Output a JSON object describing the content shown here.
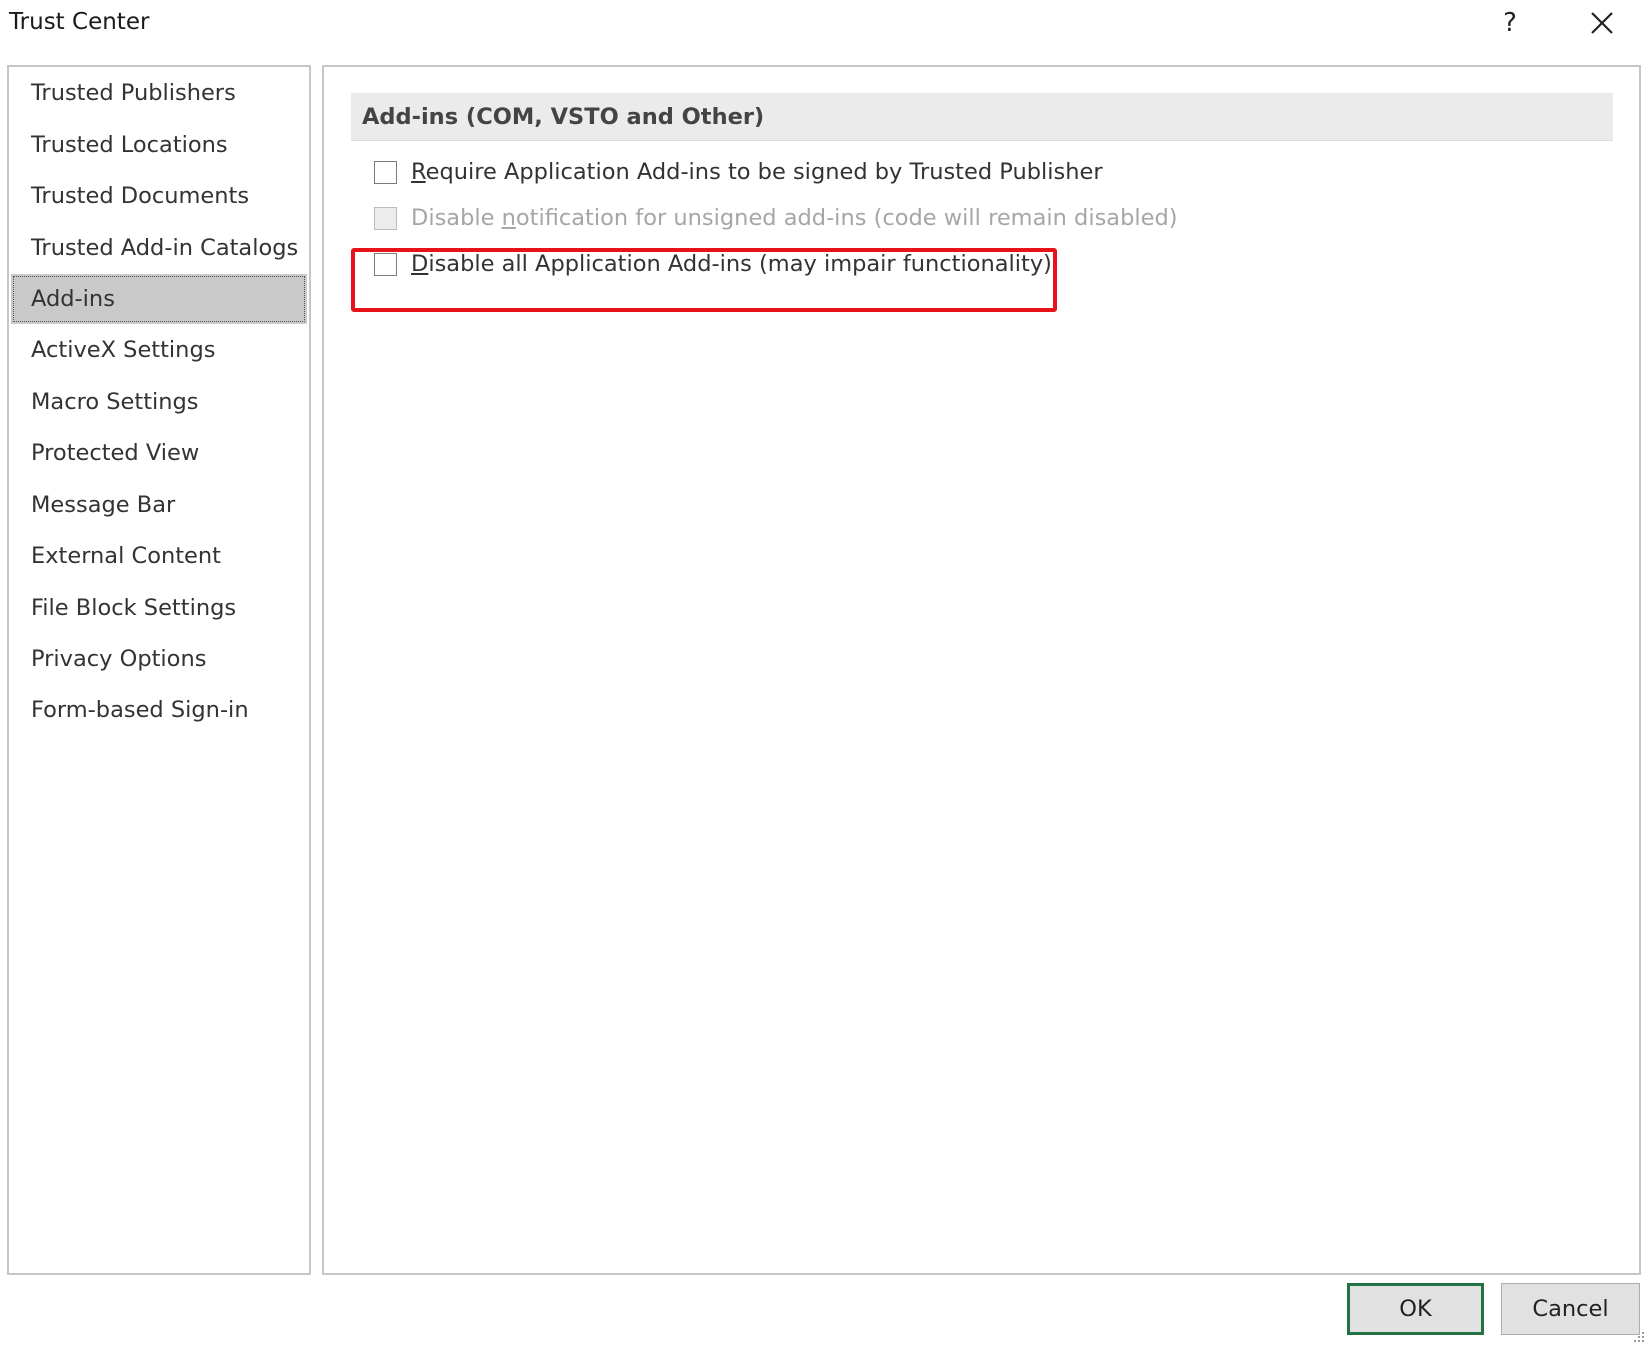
{
  "window": {
    "title": "Trust Center",
    "help_label": "?",
    "close_icon": "close-icon"
  },
  "nav": {
    "items": [
      {
        "label": "Trusted Publishers",
        "selected": false
      },
      {
        "label": "Trusted Locations",
        "selected": false
      },
      {
        "label": "Trusted Documents",
        "selected": false
      },
      {
        "label": "Trusted Add-in Catalogs",
        "selected": false
      },
      {
        "label": "Add-ins",
        "selected": true
      },
      {
        "label": "ActiveX Settings",
        "selected": false
      },
      {
        "label": "Macro Settings",
        "selected": false
      },
      {
        "label": "Protected View",
        "selected": false
      },
      {
        "label": "Message Bar",
        "selected": false
      },
      {
        "label": "External Content",
        "selected": false
      },
      {
        "label": "File Block Settings",
        "selected": false
      },
      {
        "label": "Privacy Options",
        "selected": false
      },
      {
        "label": "Form-based Sign-in",
        "selected": false
      }
    ]
  },
  "main": {
    "section_title": "Add-ins (COM, VSTO and Other)",
    "options": [
      {
        "accel": "R",
        "rest": "equire Application Add-ins to be signed by Trusted Publisher",
        "checked": false,
        "enabled": true
      },
      {
        "pre": "Disable ",
        "accel": "n",
        "rest": "otification for unsigned add-ins (code will remain disabled)",
        "checked": false,
        "enabled": false
      },
      {
        "accel": "D",
        "rest": "isable all Application Add-ins (may impair functionality)",
        "checked": false,
        "enabled": true
      }
    ],
    "highlight_color": "#e8121b"
  },
  "buttons": {
    "ok_label": "OK",
    "cancel_label": "Cancel"
  },
  "colors": {
    "accent": "#217346",
    "selected_bg": "#c9c9c9",
    "section_header_bg": "#ebebeb"
  }
}
